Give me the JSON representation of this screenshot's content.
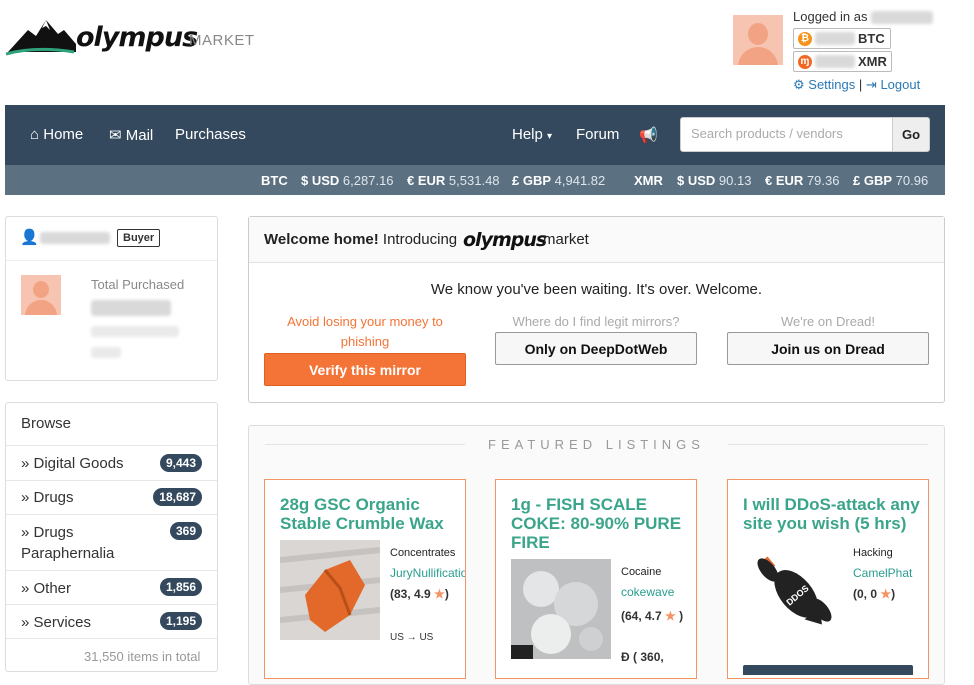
{
  "header": {
    "brand": "olympus",
    "market": "MARKET",
    "logged_in_label": "Logged in as",
    "btc_label": "BTC",
    "xmr_label": "XMR",
    "settings": "Settings",
    "separator": "|",
    "logout": "Logout"
  },
  "nav": {
    "home": "Home",
    "mail": "Mail",
    "purchases": "Purchases",
    "help": "Help",
    "forum": "Forum",
    "search_placeholder": "Search products / vendors",
    "go": "Go"
  },
  "rates": {
    "btc": "BTC",
    "btc_usd_label": "$ USD",
    "btc_usd": "6,287.16",
    "btc_eur_label": "€ EUR",
    "btc_eur": "5,531.48",
    "btc_gbp_label": "£ GBP",
    "btc_gbp": "4,941.82",
    "xmr": "XMR",
    "xmr_usd_label": "$ USD",
    "xmr_usd": "90.13",
    "xmr_eur_label": "€ EUR",
    "xmr_eur": "79.36",
    "xmr_gbp_label": "£ GBP",
    "xmr_gbp": "70.96"
  },
  "user_panel": {
    "role": "Buyer",
    "total_purchased_label": "Total Purchased"
  },
  "browse": {
    "title": "Browse",
    "categories": [
      {
        "label": "» Digital Goods",
        "count": "9,443"
      },
      {
        "label": "» Drugs",
        "count": "18,687"
      },
      {
        "label": "» Drugs Paraphernalia",
        "count": "369"
      },
      {
        "label": "» Other",
        "count": "1,856"
      },
      {
        "label": "» Services",
        "count": "1,195"
      }
    ],
    "total": "31,550 items in total"
  },
  "welcome": {
    "title_bold": "Welcome home!",
    "title_rest": "Introducing",
    "brand": "olympus",
    "market": "market",
    "subtitle": "We know you've been waiting. It's over. Welcome.",
    "col1_label": "Avoid losing your money to phishing",
    "col1_button": "Verify this mirror",
    "col2_label": "Where do I find legit mirrors?",
    "col2_button": "Only on DeepDotWeb",
    "col3_label": "We're on Dread!",
    "col3_button": "Join us on Dread"
  },
  "featured": {
    "header": "FEATURED LISTINGS",
    "listings": [
      {
        "title": "28g GSC Organic Stable Crumble Wax",
        "category": "Concentrates",
        "vendor": "JuryNullification",
        "rating": "(83, 4.9",
        "rating_end": ")",
        "shipping": "US → US"
      },
      {
        "title": "1g - FISH SCALE COKE: 80-90% PURE FIRE",
        "category": "Cocaine",
        "vendor": "cokewave",
        "rating": "(64, 4.7",
        "rating_end": ")",
        "extra": "( 360,"
      },
      {
        "title": "I will DDoS-attack any site you wish (5 hrs)",
        "category": "Hacking",
        "vendor": "CamelPhat",
        "rating": "(0, 0",
        "rating_end": ")"
      }
    ]
  },
  "colors": {
    "navbar": "#34495e",
    "ratebar": "#5b7182",
    "accent": "#f47437",
    "title_green": "#3aa58a"
  }
}
